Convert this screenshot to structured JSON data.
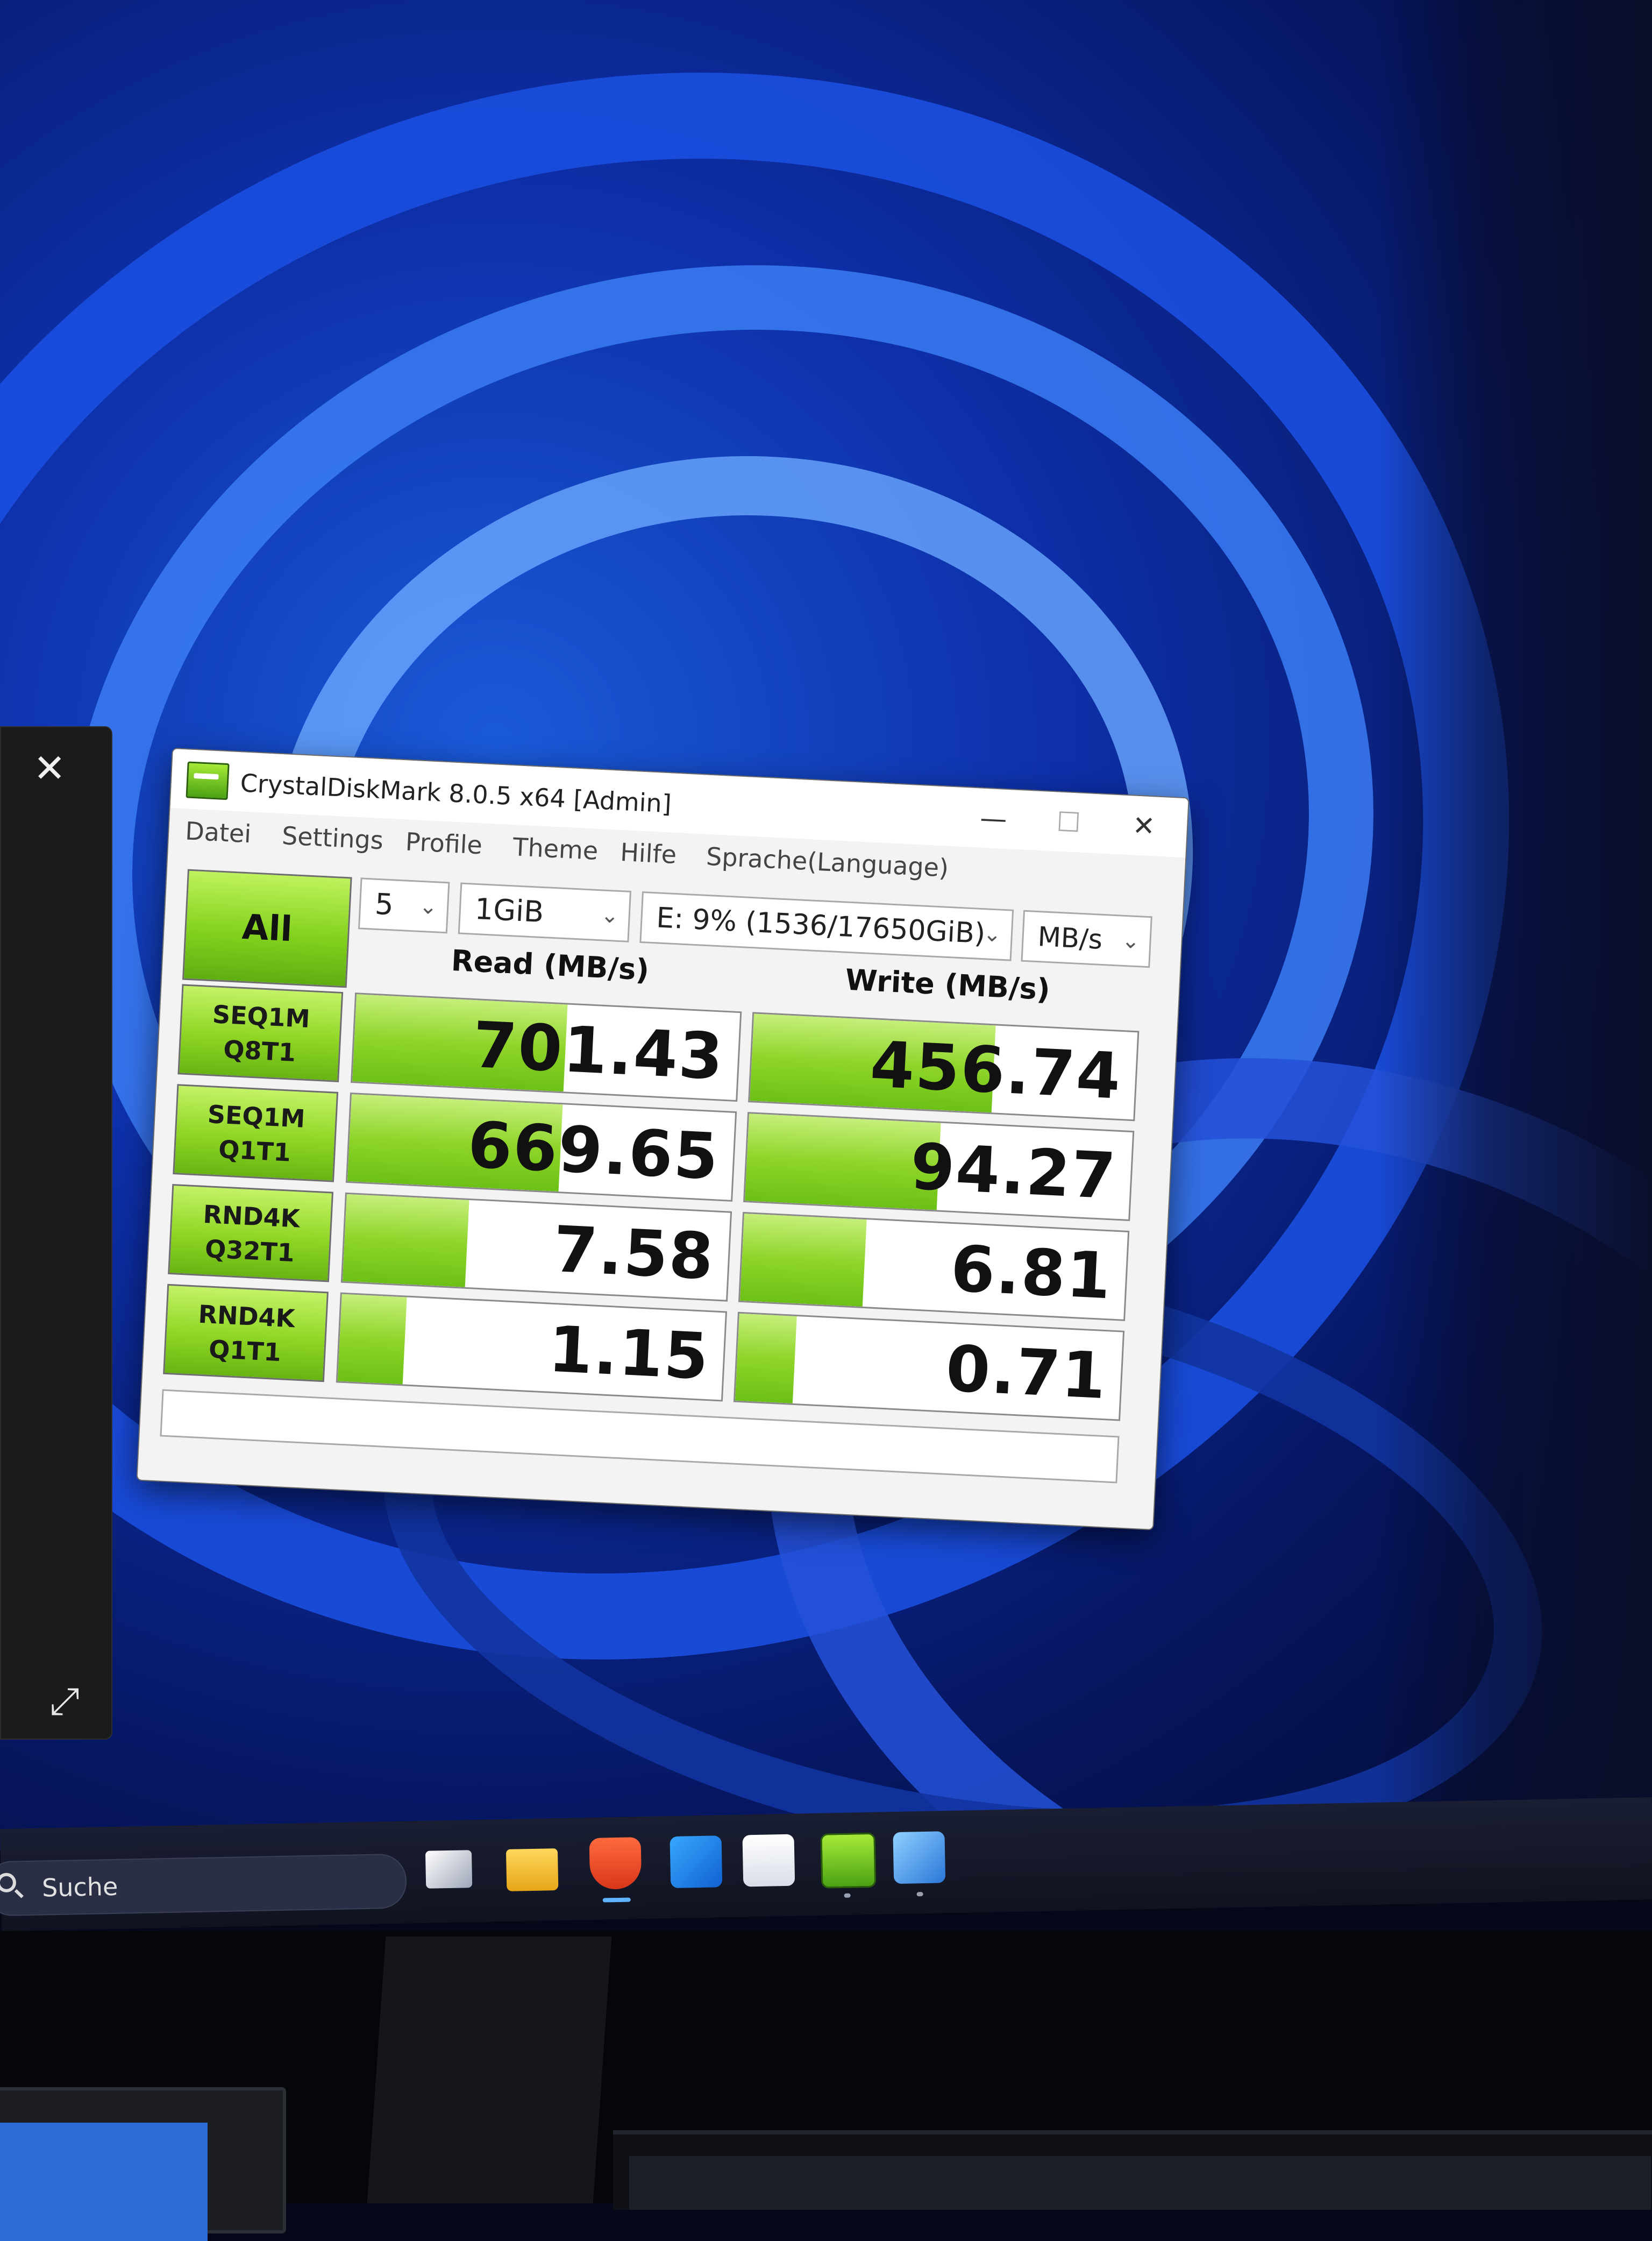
{
  "window": {
    "title": "CrystalDiskMark 8.0.5 x64 [Admin]",
    "controls": {
      "minimize": "—",
      "maximize": "☐",
      "close": "✕"
    }
  },
  "menu": [
    "Datei",
    "Settings",
    "Profile",
    "Theme",
    "Hilfe",
    "Sprache(Language)"
  ],
  "toolbar": {
    "all_button": "All",
    "count_value": "5",
    "size_value": "1GiB",
    "drive_value": "E: 9% (1536/17650GiB)",
    "unit_value": "MB/s"
  },
  "headers": {
    "read": "Read (MB/s)",
    "write": "Write (MB/s)"
  },
  "tests": [
    {
      "line1": "SEQ1M",
      "line2": "Q8T1",
      "read": "701.43",
      "write": "456.74",
      "read_fill": 0.55,
      "write_fill": 0.63
    },
    {
      "line1": "SEQ1M",
      "line2": "Q1T1",
      "read": "669.65",
      "write": "94.27",
      "read_fill": 0.55,
      "write_fill": 0.5
    },
    {
      "line1": "RND4K",
      "line2": "Q32T1",
      "read": "7.58",
      "write": "6.81",
      "read_fill": 0.32,
      "write_fill": 0.32
    },
    {
      "line1": "RND4K",
      "line2": "Q1T1",
      "read": "1.15",
      "write": "0.71",
      "read_fill": 0.17,
      "write_fill": 0.15
    }
  ],
  "side_panel": {
    "close_glyph": "✕",
    "expand_glyph": "⤢"
  },
  "taskbar": {
    "search_placeholder": "Suche",
    "apps": [
      "task-view",
      "file-explorer",
      "brave-browser",
      "outlook",
      "microsoft-store",
      "crystaldiskmark",
      "photos"
    ]
  },
  "colors": {
    "accent_green": "#8fd524",
    "wallpaper_blue": "#1b4fe0",
    "taskbar": "#141826"
  }
}
